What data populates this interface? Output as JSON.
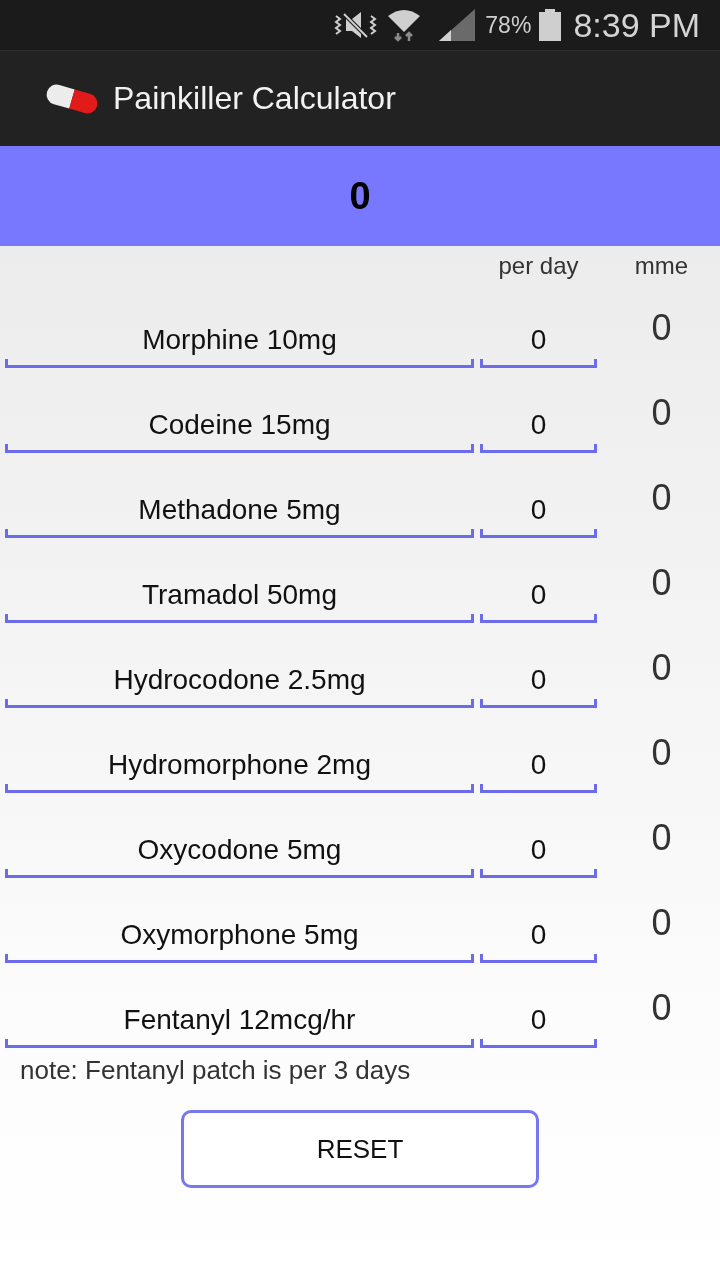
{
  "status_bar": {
    "battery_percent": "78%",
    "time": "8:39 PM"
  },
  "app_bar": {
    "title": "Painkiller Calculator"
  },
  "total": {
    "value": "0"
  },
  "table": {
    "columns": [
      "per day",
      "mme"
    ],
    "rows": [
      {
        "drug": "Morphine 10mg",
        "per_day": "0",
        "mme": "0"
      },
      {
        "drug": "Codeine 15mg",
        "per_day": "0",
        "mme": "0"
      },
      {
        "drug": "Methadone 5mg",
        "per_day": "0",
        "mme": "0"
      },
      {
        "drug": "Tramadol 50mg",
        "per_day": "0",
        "mme": "0"
      },
      {
        "drug": "Hydrocodone 2.5mg",
        "per_day": "0",
        "mme": "0"
      },
      {
        "drug": "Hydromorphone 2mg",
        "per_day": "0",
        "mme": "0"
      },
      {
        "drug": "Oxycodone 5mg",
        "per_day": "0",
        "mme": "0"
      },
      {
        "drug": "Oxymorphone 5mg",
        "per_day": "0",
        "mme": "0"
      },
      {
        "drug": "Fentanyl 12mcg/hr",
        "per_day": "0",
        "mme": "0"
      }
    ]
  },
  "note": "note: Fentanyl patch is per 3 days",
  "reset_button": {
    "label": "RESET"
  }
}
